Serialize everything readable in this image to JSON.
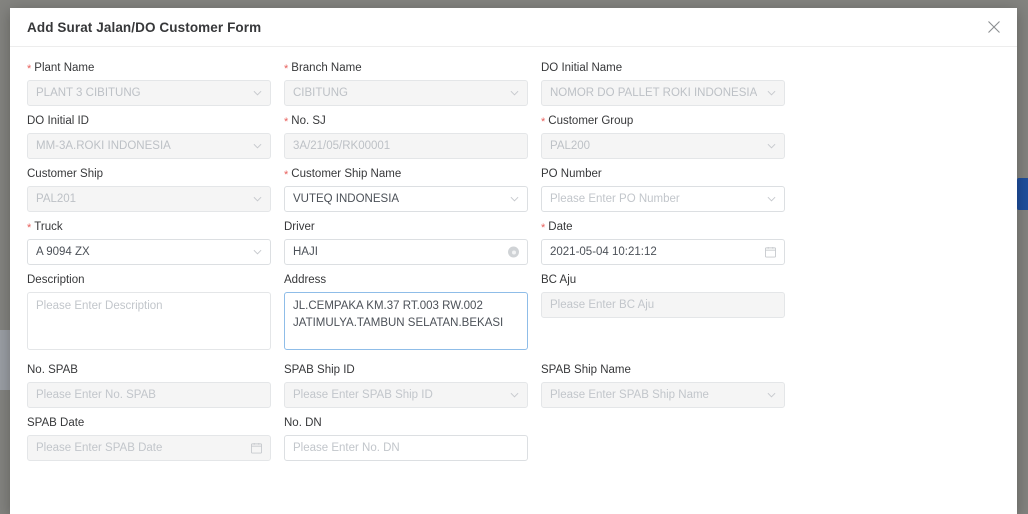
{
  "modal": {
    "title": "Add Surat Jalan/DO Customer Form",
    "close_icon": "close-icon"
  },
  "side_tab": {
    "color": "#1f4e9c"
  },
  "colors": {
    "required_asterisk": "#e8605c",
    "focus_border": "#8fbde8",
    "disabled_bg": "#f5f5f5",
    "label_text": "#37383a",
    "placeholder_text": "#c2c6cb"
  },
  "form": {
    "fields": [
      {
        "name": "plant-name",
        "label": "Plant Name",
        "required": true,
        "type": "select",
        "value": "PLANT 3 CIBITUNG",
        "placeholder": "",
        "disabled": true
      },
      {
        "name": "branch-name",
        "label": "Branch Name",
        "required": true,
        "type": "select",
        "value": "CIBITUNG",
        "placeholder": "",
        "disabled": true
      },
      {
        "name": "do-initial-name",
        "label": "DO Initial Name",
        "required": false,
        "type": "select",
        "value": "NOMOR DO PALLET ROKI INDONESIA",
        "placeholder": "",
        "disabled": true
      },
      {
        "name": "do-initial-id",
        "label": "DO Initial ID",
        "required": false,
        "type": "select",
        "value": "MM-3A.ROKI INDONESIA",
        "placeholder": "",
        "disabled": true
      },
      {
        "name": "no-sj",
        "label": "No. SJ",
        "required": true,
        "type": "text",
        "value": "3A/21/05/RK00001",
        "placeholder": "",
        "disabled": true
      },
      {
        "name": "customer-group",
        "label": "Customer Group",
        "required": true,
        "type": "select",
        "value": "PAL200",
        "placeholder": "",
        "disabled": true
      },
      {
        "name": "customer-ship",
        "label": "Customer Ship",
        "required": false,
        "type": "select",
        "value": "PAL201",
        "placeholder": "",
        "disabled": true
      },
      {
        "name": "customer-ship-name",
        "label": "Customer Ship Name",
        "required": true,
        "type": "select",
        "value": "VUTEQ INDONESIA",
        "placeholder": "",
        "disabled": false
      },
      {
        "name": "po-number",
        "label": "PO Number",
        "required": false,
        "type": "select",
        "value": "",
        "placeholder": "Please Enter PO Number",
        "disabled": false
      },
      {
        "name": "truck",
        "label": "Truck",
        "required": true,
        "type": "select",
        "value": "A 9094 ZX",
        "placeholder": "",
        "disabled": false
      },
      {
        "name": "driver",
        "label": "Driver",
        "required": false,
        "type": "text-clearable",
        "value": "HAJI",
        "placeholder": "",
        "disabled": false
      },
      {
        "name": "date",
        "label": "Date",
        "required": true,
        "type": "date",
        "value": "2021-05-04 10:21:12",
        "placeholder": "",
        "disabled": false
      },
      {
        "name": "description",
        "label": "Description",
        "required": false,
        "type": "textarea",
        "value": "",
        "placeholder": "Please Enter Description",
        "disabled": false,
        "focused": false
      },
      {
        "name": "address",
        "label": "Address",
        "required": false,
        "type": "textarea",
        "value": "JL.CEMPAKA KM.37 RT.003 RW.002 JATIMULYA.TAMBUN SELATAN.BEKASI",
        "placeholder": "",
        "disabled": false,
        "focused": true
      },
      {
        "name": "bc-aju",
        "label": "BC Aju",
        "required": false,
        "type": "text",
        "value": "",
        "placeholder": "Please Enter BC Aju",
        "disabled": true
      },
      {
        "name": "no-spab",
        "label": "No. SPAB",
        "required": false,
        "type": "text",
        "value": "",
        "placeholder": "Please Enter No. SPAB",
        "disabled": true
      },
      {
        "name": "spab-ship-id",
        "label": "SPAB Ship ID",
        "required": false,
        "type": "select",
        "value": "",
        "placeholder": "Please Enter SPAB Ship ID",
        "disabled": true
      },
      {
        "name": "spab-ship-name",
        "label": "SPAB Ship Name",
        "required": false,
        "type": "select",
        "value": "",
        "placeholder": "Please Enter SPAB Ship Name",
        "disabled": true
      },
      {
        "name": "spab-date",
        "label": "SPAB Date",
        "required": false,
        "type": "date",
        "value": "",
        "placeholder": "Please Enter SPAB Date",
        "disabled": true
      },
      {
        "name": "no-dn",
        "label": "No. DN",
        "required": false,
        "type": "text",
        "value": "",
        "placeholder": "Please Enter No. DN",
        "disabled": false
      }
    ]
  }
}
